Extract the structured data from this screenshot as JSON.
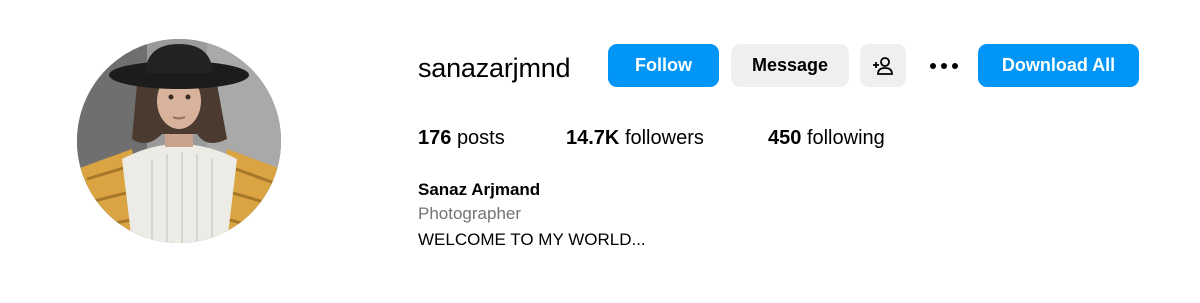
{
  "profile": {
    "username": "sanazarjmnd",
    "full_name": "Sanaz Arjmand",
    "category": "Photographer",
    "bio": "WELCOME TO MY WORLD..."
  },
  "actions": {
    "follow_label": "Follow",
    "message_label": "Message",
    "suggest_icon": "person-add-icon",
    "more_icon": "more-options-icon",
    "download_label": "Download All"
  },
  "stats": {
    "posts_count": "176",
    "posts_label": "posts",
    "followers_count": "14.7K",
    "followers_label": "followers",
    "following_count": "450",
    "following_label": "following"
  },
  "colors": {
    "primary_button": "#0095f6",
    "secondary_button": "#efefef",
    "muted_text": "#737373"
  }
}
